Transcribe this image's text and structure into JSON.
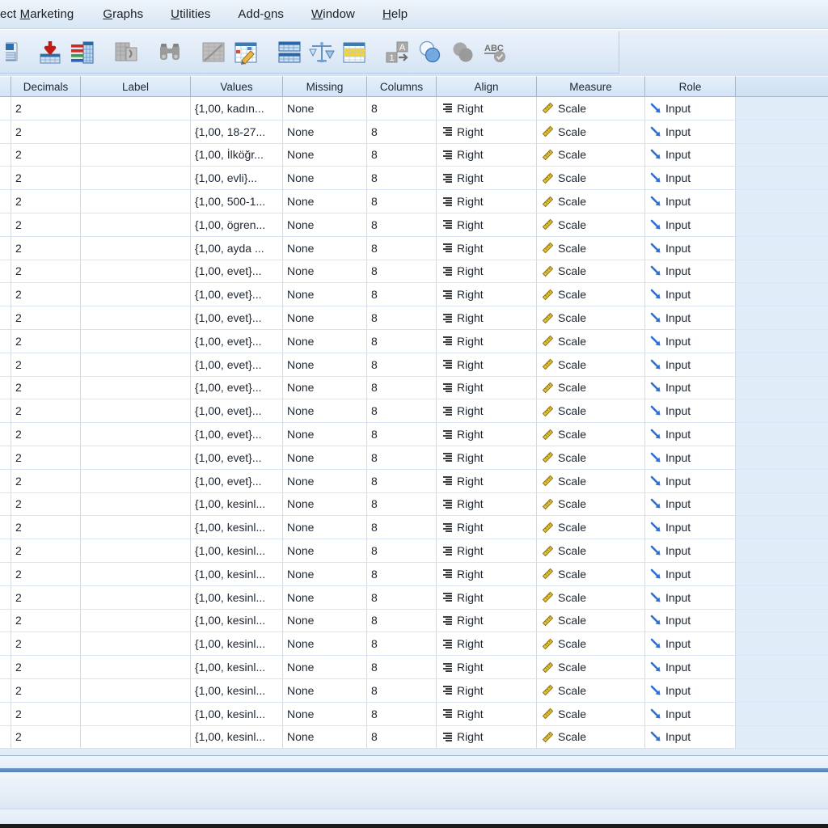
{
  "menu": {
    "items": [
      {
        "label": "ect Marketing",
        "accel": "M",
        "name": "menu-direct-marketing"
      },
      {
        "label": "Graphs",
        "accel": "G",
        "name": "menu-graphs"
      },
      {
        "label": "Utilities",
        "accel": "U",
        "name": "menu-utilities"
      },
      {
        "label": "Add-ons",
        "accel": "o",
        "name": "menu-addons"
      },
      {
        "label": "Window",
        "accel": "W",
        "name": "menu-window"
      },
      {
        "label": "Help",
        "accel": "H",
        "name": "menu-help"
      }
    ]
  },
  "toolbar": {
    "buttons": [
      {
        "icon": "save-file-icon",
        "enabled": true
      },
      {
        "icon": "import-data-icon",
        "enabled": true
      },
      {
        "icon": "recode-bars-icon",
        "enabled": true
      },
      {
        "icon": "split-file-gray-icon",
        "enabled": false
      },
      {
        "icon": "find-binoculars-icon",
        "enabled": true
      },
      {
        "icon": "select-cases-gray-icon",
        "enabled": false
      },
      {
        "icon": "weight-cases-pencil-icon",
        "enabled": true
      },
      {
        "icon": "split-file-blue-icon",
        "enabled": true
      },
      {
        "icon": "weight-scales-icon",
        "enabled": true
      },
      {
        "icon": "select-cases-yellow-icon",
        "enabled": true
      },
      {
        "icon": "value-labels-icon",
        "enabled": true
      },
      {
        "icon": "use-variable-sets-icon",
        "enabled": true
      },
      {
        "icon": "show-all-variables-gray-icon",
        "enabled": false
      },
      {
        "icon": "spell-check-abc-icon",
        "enabled": true
      }
    ]
  },
  "grid": {
    "headers": [
      {
        "label": "Decimals",
        "name": "column-header-decimals"
      },
      {
        "label": "Label",
        "name": "column-header-label"
      },
      {
        "label": "Values",
        "name": "column-header-values"
      },
      {
        "label": "Missing",
        "name": "column-header-missing"
      },
      {
        "label": "Columns",
        "name": "column-header-columns"
      },
      {
        "label": "Align",
        "name": "column-header-align"
      },
      {
        "label": "Measure",
        "name": "column-header-measure"
      },
      {
        "label": "Role",
        "name": "column-header-role"
      }
    ],
    "common": {
      "decimals": "2",
      "label": "",
      "missing": "None",
      "columns": "8",
      "align": "Right",
      "measure": "Scale",
      "role": "Input"
    },
    "rows": [
      {
        "values": "{1,00, kadın..."
      },
      {
        "values": "{1,00, 18-27..."
      },
      {
        "values": "{1,00, İlköğr..."
      },
      {
        "values": "{1,00, evli}..."
      },
      {
        "values": "{1,00, 500-1..."
      },
      {
        "values": "{1,00, ögren..."
      },
      {
        "values": "{1,00, ayda ..."
      },
      {
        "values": "{1,00, evet}..."
      },
      {
        "values": "{1,00, evet}..."
      },
      {
        "values": "{1,00, evet}..."
      },
      {
        "values": "{1,00, evet}..."
      },
      {
        "values": "{1,00, evet}..."
      },
      {
        "values": "{1,00, evet}..."
      },
      {
        "values": "{1,00, evet}..."
      },
      {
        "values": "{1,00, evet}..."
      },
      {
        "values": "{1,00, evet}..."
      },
      {
        "values": "{1,00, evet}..."
      },
      {
        "values": "{1,00, kesinl..."
      },
      {
        "values": "{1,00, kesinl..."
      },
      {
        "values": "{1,00, kesinl..."
      },
      {
        "values": "{1,00, kesinl..."
      },
      {
        "values": "{1,00, kesinl..."
      },
      {
        "values": "{1,00, kesinl..."
      },
      {
        "values": "{1,00, kesinl..."
      },
      {
        "values": "{1,00, kesinl..."
      },
      {
        "values": "{1,00, kesinl..."
      },
      {
        "values": "{1,00, kesinl..."
      },
      {
        "values": "{1,00, kesinl..."
      }
    ]
  },
  "colors": {
    "header_blue": "#d3e4f6",
    "grid_empty": "#e0ecf8",
    "accent_blue": "#4f7fb5",
    "measure_icon": "#d8b400",
    "role_icon": "#2f6fd0"
  }
}
